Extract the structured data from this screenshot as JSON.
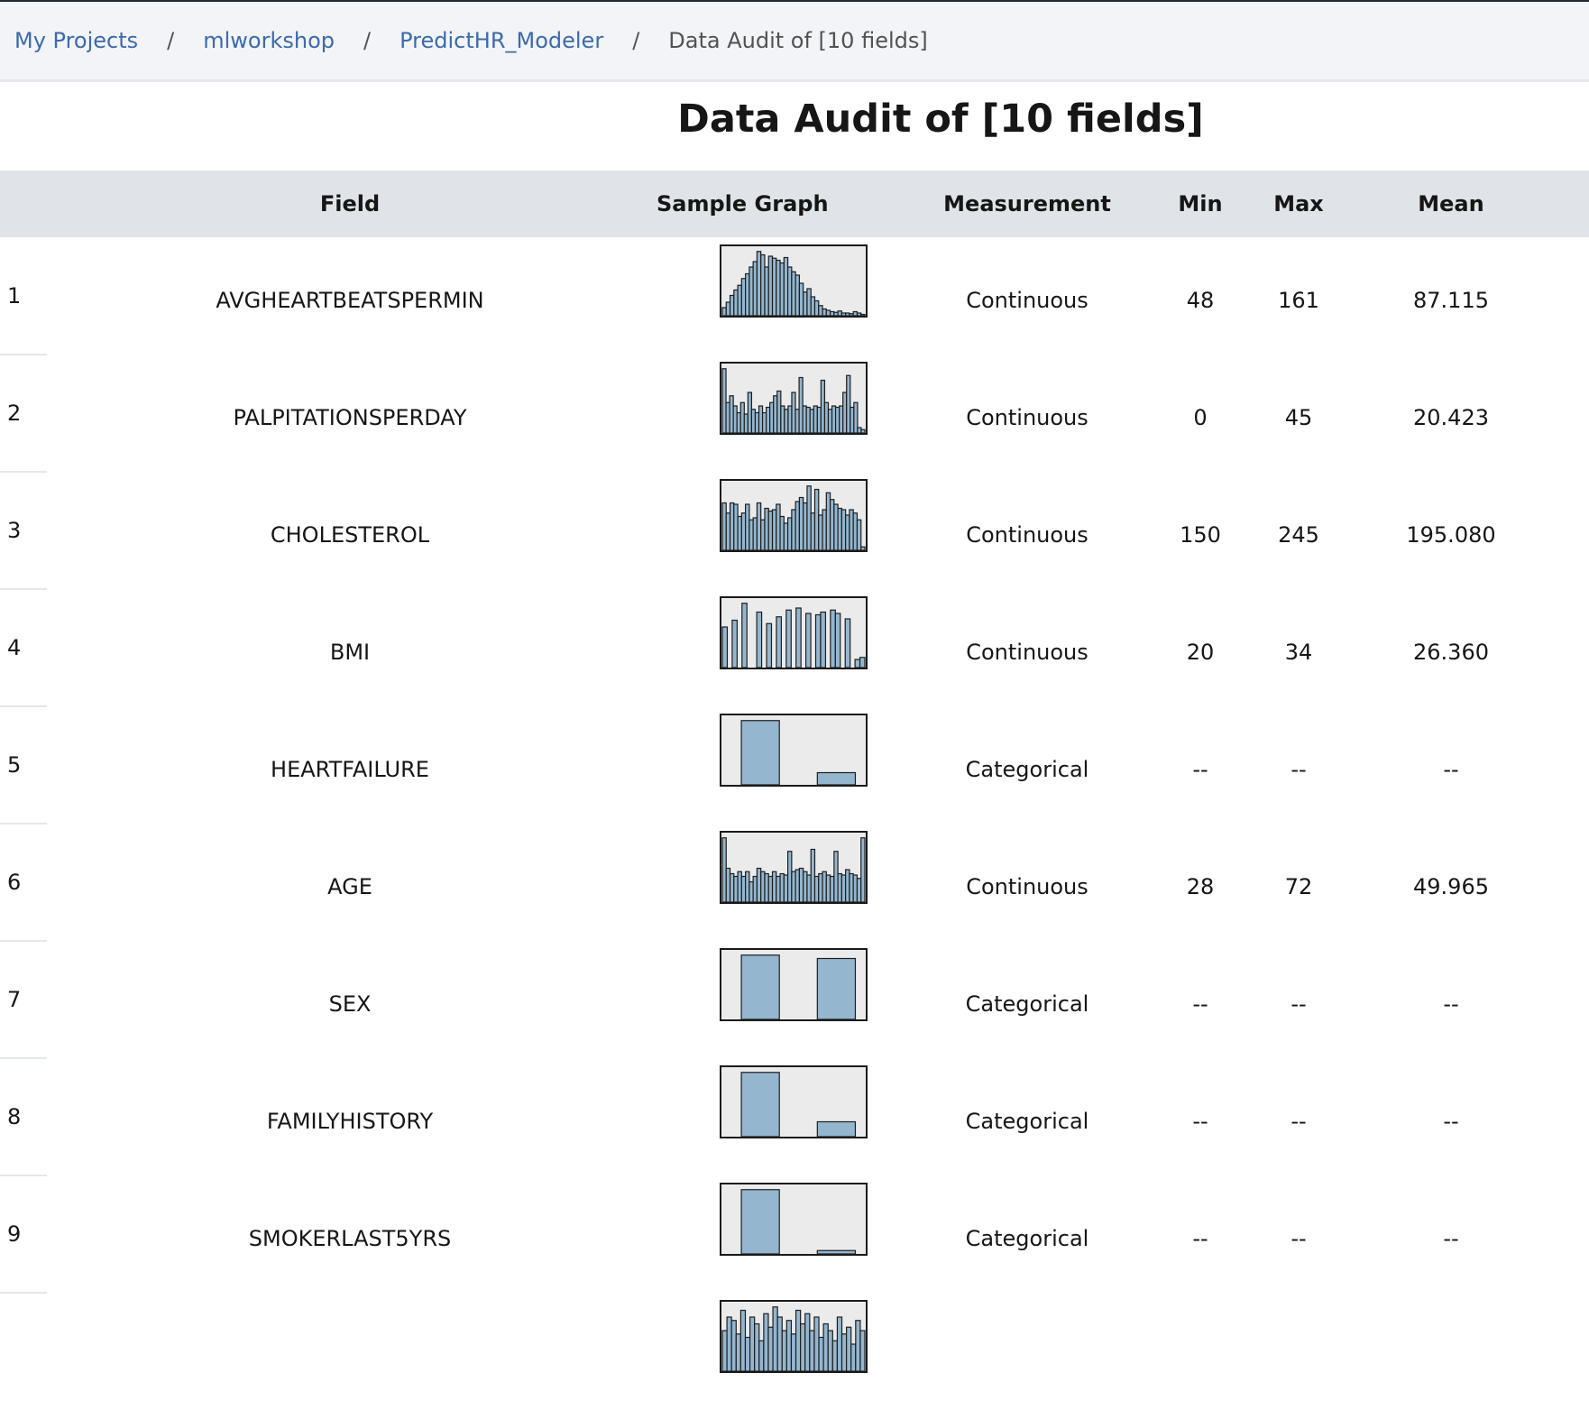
{
  "breadcrumb": [
    {
      "label": "My Projects"
    },
    {
      "label": "mlworkshop"
    },
    {
      "label": "PredictHR_Modeler"
    },
    {
      "label": "Data Audit of [10 fields]"
    }
  ],
  "breadcrumb_separator": "/",
  "title": "Data Audit of [10 fields]",
  "columns": {
    "index": "",
    "field": "Field",
    "graph": "Sample Graph",
    "measurement": "Measurement",
    "min": "Min",
    "max": "Max",
    "mean": "Mean"
  },
  "colors": {
    "bar_fill": "#94b6cf",
    "bar_stroke": "#1e1e1e",
    "graph_bg": "#ebebeb",
    "header_bg": "#e0e4e8",
    "link": "#3d6aad"
  },
  "rows": [
    {
      "index": "1",
      "field": "AVGHEARTBEATSPERMIN",
      "measurement": "Continuous",
      "min": "48",
      "max": "161",
      "mean": "87.115",
      "hist": [
        0.12,
        0.2,
        0.3,
        0.38,
        0.45,
        0.55,
        0.62,
        0.72,
        0.8,
        0.95,
        0.9,
        0.72,
        0.88,
        0.85,
        0.82,
        0.78,
        0.86,
        0.72,
        0.65,
        0.6,
        0.48,
        0.35,
        0.4,
        0.28,
        0.22,
        0.15,
        0.1,
        0.08,
        0.06,
        0.05,
        0.07,
        0.04,
        0.04,
        0.03,
        0.06,
        0.04,
        0.02
      ]
    },
    {
      "index": "2",
      "field": "PALPITATIONSPERDAY",
      "measurement": "Continuous",
      "min": "0",
      "max": "45",
      "mean": "20.423",
      "hist": [
        0.95,
        0.45,
        0.55,
        0.4,
        0.3,
        0.45,
        0.28,
        0.6,
        0.35,
        0.3,
        0.4,
        0.3,
        0.38,
        0.45,
        0.55,
        0.62,
        0.4,
        0.35,
        0.4,
        0.6,
        0.35,
        0.82,
        0.4,
        0.38,
        0.35,
        0.4,
        0.38,
        0.78,
        0.45,
        0.35,
        0.4,
        0.38,
        0.4,
        0.6,
        0.85,
        0.38,
        0.45,
        0.08,
        0.05
      ]
    },
    {
      "index": "3",
      "field": "CHOLESTEROL",
      "measurement": "Continuous",
      "min": "150",
      "max": "245",
      "mean": "195.080",
      "hist": [
        0.7,
        0.55,
        0.7,
        0.68,
        0.5,
        0.55,
        0.68,
        0.45,
        0.48,
        0.7,
        0.45,
        0.62,
        0.58,
        0.6,
        0.68,
        0.5,
        0.4,
        0.48,
        0.6,
        0.72,
        0.78,
        0.7,
        0.95,
        0.55,
        0.9,
        0.52,
        0.6,
        0.85,
        0.75,
        0.68,
        0.62,
        0.6,
        0.52,
        0.6,
        0.55,
        0.45,
        0.05
      ]
    },
    {
      "index": "4",
      "field": "BMI",
      "measurement": "Continuous",
      "min": "20",
      "max": "34",
      "mean": "26.360",
      "hist": [
        0.6,
        0,
        0.7,
        0,
        0.95,
        0,
        0,
        0.82,
        0,
        0.65,
        0,
        0.75,
        0,
        0.85,
        0,
        0.88,
        0,
        0.8,
        0,
        0.78,
        0.82,
        0,
        0.85,
        0.8,
        0,
        0.72,
        0,
        0.12,
        0.15
      ]
    },
    {
      "index": "5",
      "field": "HEARTFAILURE",
      "measurement": "Categorical",
      "min": "--",
      "max": "--",
      "mean": "--",
      "hist": [
        0,
        0,
        0.95,
        0.95,
        0.95,
        0.95,
        0,
        0,
        0,
        0,
        0.18,
        0.18,
        0.18,
        0.18,
        0
      ]
    },
    {
      "index": "6",
      "field": "AGE",
      "measurement": "Continuous",
      "min": "28",
      "max": "72",
      "mean": "49.965",
      "hist": [
        0.95,
        0.5,
        0.42,
        0.38,
        0.45,
        0.38,
        0.45,
        0.3,
        0.38,
        0.5,
        0.45,
        0.42,
        0.38,
        0.45,
        0.38,
        0.42,
        0.4,
        0.75,
        0.45,
        0.48,
        0.5,
        0.45,
        0.4,
        0.78,
        0.38,
        0.42,
        0.45,
        0.4,
        0.38,
        0.75,
        0.42,
        0.4,
        0.48,
        0.42,
        0.4,
        0.35,
        0.95
      ]
    },
    {
      "index": "7",
      "field": "SEX",
      "measurement": "Categorical",
      "min": "--",
      "max": "--",
      "mean": "--",
      "hist": [
        0,
        0,
        0.95,
        0.95,
        0.95,
        0.95,
        0,
        0,
        0,
        0,
        0.9,
        0.9,
        0.9,
        0.9,
        0
      ]
    },
    {
      "index": "8",
      "field": "FAMILYHISTORY",
      "measurement": "Categorical",
      "min": "--",
      "max": "--",
      "mean": "--",
      "hist": [
        0,
        0,
        0.95,
        0.95,
        0.95,
        0.95,
        0,
        0,
        0,
        0,
        0.22,
        0.22,
        0.22,
        0.22,
        0
      ]
    },
    {
      "index": "9",
      "field": "SMOKERLAST5YRS",
      "measurement": "Categorical",
      "min": "--",
      "max": "--",
      "mean": "--",
      "hist": [
        0,
        0,
        0.95,
        0.95,
        0.95,
        0.95,
        0,
        0,
        0,
        0,
        0.05,
        0.05,
        0.05,
        0.05,
        0
      ]
    },
    {
      "index": "",
      "field": "",
      "measurement": "",
      "min": "",
      "max": "",
      "mean": "",
      "hist": [
        0.6,
        0.8,
        0.75,
        0.55,
        0.9,
        0.5,
        0.8,
        0.7,
        0.45,
        0.85,
        0.65,
        0.95,
        0.8,
        0.6,
        0.75,
        0.55,
        0.9,
        0.7,
        0.85,
        0.6,
        0.8,
        0.5,
        0.7,
        0.6,
        0.45,
        0.8,
        0.55,
        0.65,
        0.4,
        0.75,
        0.6
      ]
    }
  ]
}
